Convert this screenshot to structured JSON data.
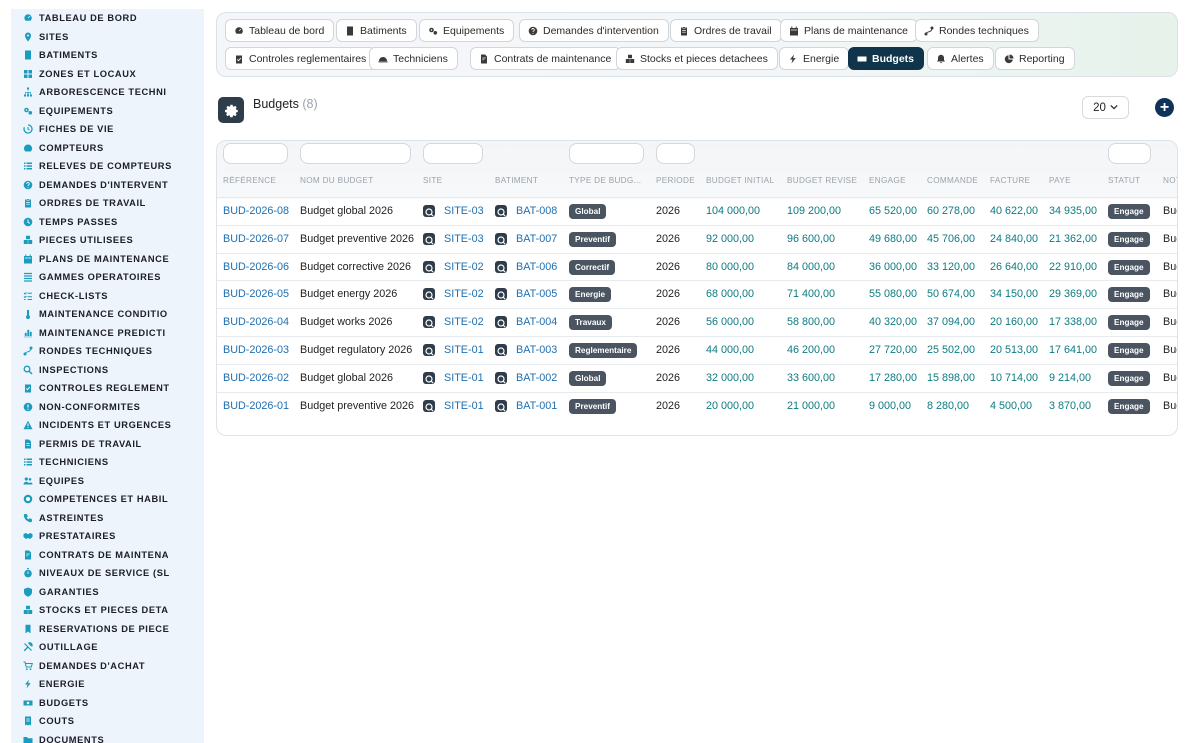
{
  "sidebar": {
    "items": [
      {
        "label": "TABLEAU DE BORD",
        "icon": "dashboard-icon"
      },
      {
        "label": "SITES",
        "icon": "map-pin-icon"
      },
      {
        "label": "BATIMENTS",
        "icon": "building-icon"
      },
      {
        "label": "ZONES ET LOCAUX",
        "icon": "grid-icon"
      },
      {
        "label": "ARBORESCENCE TECHNI",
        "icon": "tree-icon"
      },
      {
        "label": "EQUIPEMENTS",
        "icon": "gears-icon"
      },
      {
        "label": "FICHES DE VIE",
        "icon": "history-icon"
      },
      {
        "label": "COMPTEURS",
        "icon": "gauge-icon"
      },
      {
        "label": "RELEVES DE COMPTEURS",
        "icon": "list-icon"
      },
      {
        "label": "DEMANDES D'INTERVENT",
        "icon": "question-icon"
      },
      {
        "label": "ORDRES DE TRAVAIL",
        "icon": "clipboard-icon"
      },
      {
        "label": "TEMPS PASSES",
        "icon": "clock-icon"
      },
      {
        "label": "PIECES UTILISEES",
        "icon": "boxes-icon"
      },
      {
        "label": "PLANS DE MAINTENANCE",
        "icon": "calendar-icon"
      },
      {
        "label": "GAMMES OPERATOIRES",
        "icon": "tasks-icon"
      },
      {
        "label": "CHECK-LISTS",
        "icon": "checklist-icon"
      },
      {
        "label": "MAINTENANCE CONDITIO",
        "icon": "thermometer-icon"
      },
      {
        "label": "MAINTENANCE PREDICTI",
        "icon": "chart-icon"
      },
      {
        "label": "RONDES TECHNIQUES",
        "icon": "route-icon"
      },
      {
        "label": "INSPECTIONS",
        "icon": "search-icon"
      },
      {
        "label": "CONTROLES REGLEMENT",
        "icon": "clipboard-check-icon"
      },
      {
        "label": "NON-CONFORMITES",
        "icon": "alert-circle-icon"
      },
      {
        "label": "INCIDENTS ET URGENCES",
        "icon": "warning-icon"
      },
      {
        "label": "PERMIS DE TRAVAIL",
        "icon": "document-icon"
      },
      {
        "label": "TECHNICIENS",
        "icon": "list-icon"
      },
      {
        "label": "EQUIPES",
        "icon": "users-icon"
      },
      {
        "label": "COMPETENCES ET HABIL",
        "icon": "badge-icon"
      },
      {
        "label": "ASTREINTES",
        "icon": "phone-icon"
      },
      {
        "label": "PRESTATAIRES",
        "icon": "handshake-icon"
      },
      {
        "label": "CONTRATS DE MAINTENA",
        "icon": "file-contract-icon"
      },
      {
        "label": "NIVEAUX DE SERVICE (SL",
        "icon": "stopwatch-icon"
      },
      {
        "label": "GARANTIES",
        "icon": "shield-icon"
      },
      {
        "label": "STOCKS ET PIECES DETA",
        "icon": "boxes-icon"
      },
      {
        "label": "RESERVATIONS DE PIECE",
        "icon": "bookmark-icon"
      },
      {
        "label": "OUTILLAGE",
        "icon": "tools-icon"
      },
      {
        "label": "DEMANDES D'ACHAT",
        "icon": "cart-icon"
      },
      {
        "label": "ENERGIE",
        "icon": "bolt-icon"
      },
      {
        "label": "BUDGETS",
        "icon": "money-icon"
      },
      {
        "label": "COUTS",
        "icon": "receipt-icon"
      },
      {
        "label": "DOCUMENTS",
        "icon": "folder-icon"
      }
    ]
  },
  "tabs": {
    "row1": [
      {
        "label": "Tableau de bord",
        "icon": "dashboard-icon"
      },
      {
        "label": "Batiments",
        "icon": "building-icon"
      },
      {
        "label": "Equipements",
        "icon": "gears-icon"
      },
      {
        "label": "Demandes d'intervention",
        "icon": "question-icon"
      },
      {
        "label": "Ordres de travail",
        "icon": "clipboard-icon"
      },
      {
        "label": "Plans de maintenance",
        "icon": "calendar-icon"
      },
      {
        "label": "Rondes techniques",
        "icon": "route-icon"
      }
    ],
    "row2": [
      {
        "label": "Controles reglementaires",
        "icon": "clipboard-check-icon"
      },
      {
        "label": "Techniciens",
        "icon": "helmet-icon"
      },
      {
        "label": "Contrats de maintenance",
        "icon": "file-contract-icon"
      },
      {
        "label": "Stocks et pieces detachees",
        "icon": "boxes-icon"
      },
      {
        "label": "Energie",
        "icon": "bolt-icon"
      },
      {
        "label": "Budgets",
        "icon": "money-icon",
        "active": true
      },
      {
        "label": "Alertes",
        "icon": "bell-icon"
      },
      {
        "label": "Reporting",
        "icon": "pie-chart-icon"
      }
    ]
  },
  "page": {
    "title": "Budgets",
    "count": "(8)",
    "per_page": "20"
  },
  "table": {
    "columns": [
      "RÉFÉRENCE",
      "NOM DU BUDGET",
      "SITE",
      "BATIMENT",
      "TYPE DE BUDG...",
      "PERIODE",
      "BUDGET INITIAL",
      "BUDGET REVISE",
      "ENGAGE",
      "COMMANDE",
      "FACTURE",
      "PAYE",
      "STATUT",
      "NOT"
    ],
    "rows": [
      {
        "ref": "BUD-2026-08",
        "name": "Budget global 2026",
        "site": "SITE-03",
        "bat": "BAT-008",
        "type": "Global",
        "period": "2026",
        "initial": "104 000,00",
        "revised": "109 200,00",
        "engage": "65 520,00",
        "commande": "60 278,00",
        "facture": "40 622,00",
        "paye": "34 935,00",
        "status": "Engage",
        "note": "Bud"
      },
      {
        "ref": "BUD-2026-07",
        "name": "Budget preventive 2026",
        "site": "SITE-03",
        "bat": "BAT-007",
        "type": "Preventif",
        "period": "2026",
        "initial": "92 000,00",
        "revised": "96 600,00",
        "engage": "49 680,00",
        "commande": "45 706,00",
        "facture": "24 840,00",
        "paye": "21 362,00",
        "status": "Engage",
        "note": "Bud"
      },
      {
        "ref": "BUD-2026-06",
        "name": "Budget corrective 2026",
        "site": "SITE-02",
        "bat": "BAT-006",
        "type": "Correctif",
        "period": "2026",
        "initial": "80 000,00",
        "revised": "84 000,00",
        "engage": "36 000,00",
        "commande": "33 120,00",
        "facture": "26 640,00",
        "paye": "22 910,00",
        "status": "Engage",
        "note": "Bud"
      },
      {
        "ref": "BUD-2026-05",
        "name": "Budget energy 2026",
        "site": "SITE-02",
        "bat": "BAT-005",
        "type": "Energie",
        "period": "2026",
        "initial": "68 000,00",
        "revised": "71 400,00",
        "engage": "55 080,00",
        "commande": "50 674,00",
        "facture": "34 150,00",
        "paye": "29 369,00",
        "status": "Engage",
        "note": "Bud"
      },
      {
        "ref": "BUD-2026-04",
        "name": "Budget works 2026",
        "site": "SITE-02",
        "bat": "BAT-004",
        "type": "Travaux",
        "period": "2026",
        "initial": "56 000,00",
        "revised": "58 800,00",
        "engage": "40 320,00",
        "commande": "37 094,00",
        "facture": "20 160,00",
        "paye": "17 338,00",
        "status": "Engage",
        "note": "Bud"
      },
      {
        "ref": "BUD-2026-03",
        "name": "Budget regulatory 2026",
        "site": "SITE-01",
        "bat": "BAT-003",
        "type": "Reglementaire",
        "period": "2026",
        "initial": "44 000,00",
        "revised": "46 200,00",
        "engage": "27 720,00",
        "commande": "25 502,00",
        "facture": "20 513,00",
        "paye": "17 641,00",
        "status": "Engage",
        "note": "Bud"
      },
      {
        "ref": "BUD-2026-02",
        "name": "Budget global 2026",
        "site": "SITE-01",
        "bat": "BAT-002",
        "type": "Global",
        "period": "2026",
        "initial": "32 000,00",
        "revised": "33 600,00",
        "engage": "17 280,00",
        "commande": "15 898,00",
        "facture": "10 714,00",
        "paye": "9 214,00",
        "status": "Engage",
        "note": "Bud"
      },
      {
        "ref": "BUD-2026-01",
        "name": "Budget preventive 2026",
        "site": "SITE-01",
        "bat": "BAT-001",
        "type": "Preventif",
        "period": "2026",
        "initial": "20 000,00",
        "revised": "21 000,00",
        "engage": "9 000,00",
        "commande": "8 280,00",
        "facture": "4 500,00",
        "paye": "3 870,00",
        "status": "Engage",
        "note": "Bud"
      }
    ]
  },
  "colors": {
    "accent": "#1a9cbf",
    "active_tab": "#10344a",
    "link": "#1f6fb0",
    "number": "#0d7b80",
    "badge": "#4a5561"
  }
}
